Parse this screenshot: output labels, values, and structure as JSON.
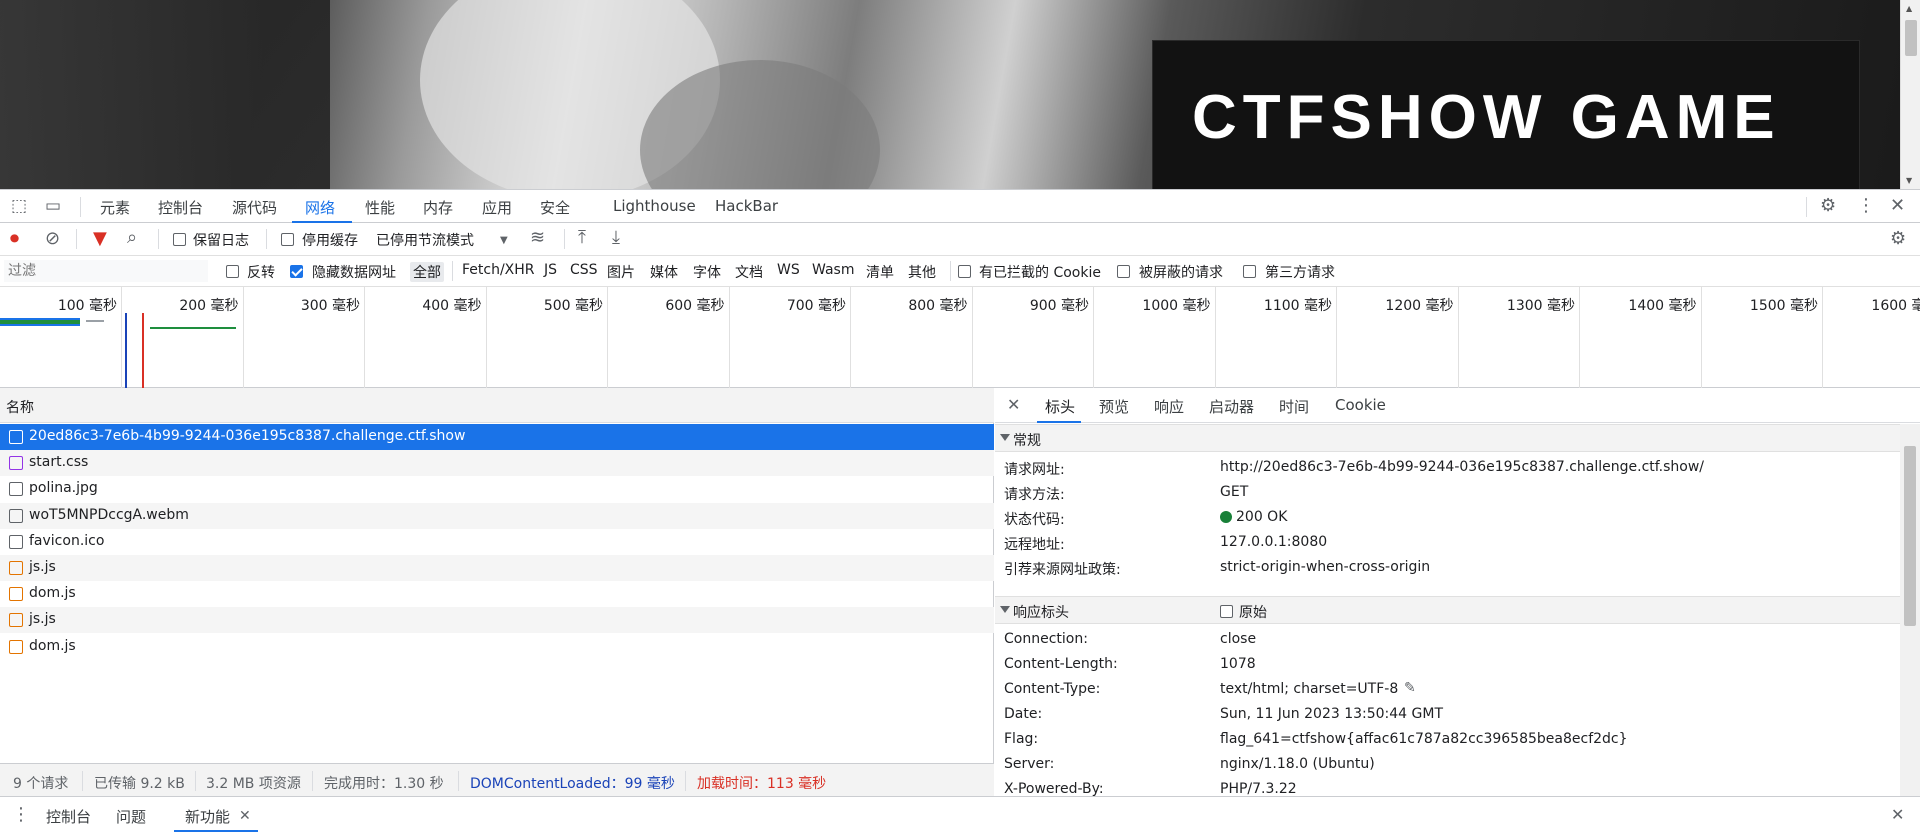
{
  "page": {
    "title": "CTFSHOW GAME"
  },
  "devtools": {
    "tabs": [
      "元素",
      "控制台",
      "源代码",
      "网络",
      "性能",
      "内存",
      "应用",
      "安全",
      "Lighthouse",
      "HackBar"
    ],
    "toolbar": {
      "preserve_log": "保留日志",
      "disable_cache": "停用缓存",
      "throttling": "已停用节流模式"
    },
    "filterbar": {
      "placeholder": "过滤",
      "invert": "反转",
      "hide_data_urls": "隐藏数据网址",
      "types": [
        "全部",
        "Fetch/XHR",
        "JS",
        "CSS",
        "图片",
        "媒体",
        "字体",
        "文档",
        "WS",
        "Wasm",
        "清单",
        "其他"
      ],
      "blocked_cookies": "有已拦截的 Cookie",
      "blocked_requests": "被屏蔽的请求",
      "third_party": "第三方请求"
    },
    "timeline_ticks": [
      "100 毫秒",
      "200 毫秒",
      "300 毫秒",
      "400 毫秒",
      "500 毫秒",
      "600 毫秒",
      "700 毫秒",
      "800 毫秒",
      "900 毫秒",
      "1000 毫秒",
      "1100 毫秒",
      "1200 毫秒",
      "1300 毫秒",
      "1400 毫秒",
      "1500 毫秒",
      "1600 毫秒"
    ],
    "requests": {
      "header": "名称",
      "rows": [
        {
          "name": "20ed86c3-7e6b-4b99-9244-036e195c8387.challenge.ctf.show",
          "kind": "document"
        },
        {
          "name": "start.css",
          "kind": "stylesheet"
        },
        {
          "name": "polina.jpg",
          "kind": "image"
        },
        {
          "name": "woT5MNPDccgA.webm",
          "kind": "media"
        },
        {
          "name": "favicon.ico",
          "kind": "other"
        },
        {
          "name": "js.js",
          "kind": "script"
        },
        {
          "name": "dom.js",
          "kind": "script"
        },
        {
          "name": "js.js",
          "kind": "script"
        },
        {
          "name": "dom.js",
          "kind": "script"
        }
      ]
    },
    "status": {
      "requests": "9 个请求",
      "transferred": "已传输 9.2 kB",
      "resources": "3.2 MB 项资源",
      "finish": "完成用时：1.30 秒",
      "dcl": "DOMContentLoaded：99 毫秒",
      "load": "加载时间：113 毫秒"
    },
    "details": {
      "tabs": [
        "标头",
        "预览",
        "响应",
        "启动器",
        "时间",
        "Cookie"
      ],
      "general": {
        "title": "常规",
        "items": [
          {
            "k": "请求网址:",
            "v": "http://20ed86c3-7e6b-4b99-9244-036e195c8387.challenge.ctf.show/"
          },
          {
            "k": "请求方法:",
            "v": "GET"
          },
          {
            "k": "状态代码:",
            "v": "200 OK"
          },
          {
            "k": "远程地址:",
            "v": "127.0.0.1:8080"
          },
          {
            "k": "引荐来源网址政策:",
            "v": "strict-origin-when-cross-origin"
          }
        ]
      },
      "response_headers": {
        "title": "响应标头",
        "raw_label": "原始",
        "items": [
          {
            "k": "Connection:",
            "v": "close"
          },
          {
            "k": "Content-Length:",
            "v": "1078"
          },
          {
            "k": "Content-Type:",
            "v": "text/html; charset=UTF-8"
          },
          {
            "k": "Date:",
            "v": "Sun, 11 Jun 2023 13:50:44 GMT"
          },
          {
            "k": "Flag:",
            "v": "flag_641=ctfshow{affac61c787a82cc396585bea8ecf2dc}"
          },
          {
            "k": "Server:",
            "v": "nginx/1.18.0 (Ubuntu)"
          },
          {
            "k": "X-Powered-By:",
            "v": "PHP/7.3.22"
          }
        ]
      }
    },
    "drawer": {
      "tabs": [
        "控制台",
        "问题",
        "新功能"
      ]
    },
    "colors": {
      "accent": "#1a73e8",
      "status_ok": "#188038",
      "load_red": "#d93025",
      "dcl_blue": "#1a43b8"
    }
  }
}
